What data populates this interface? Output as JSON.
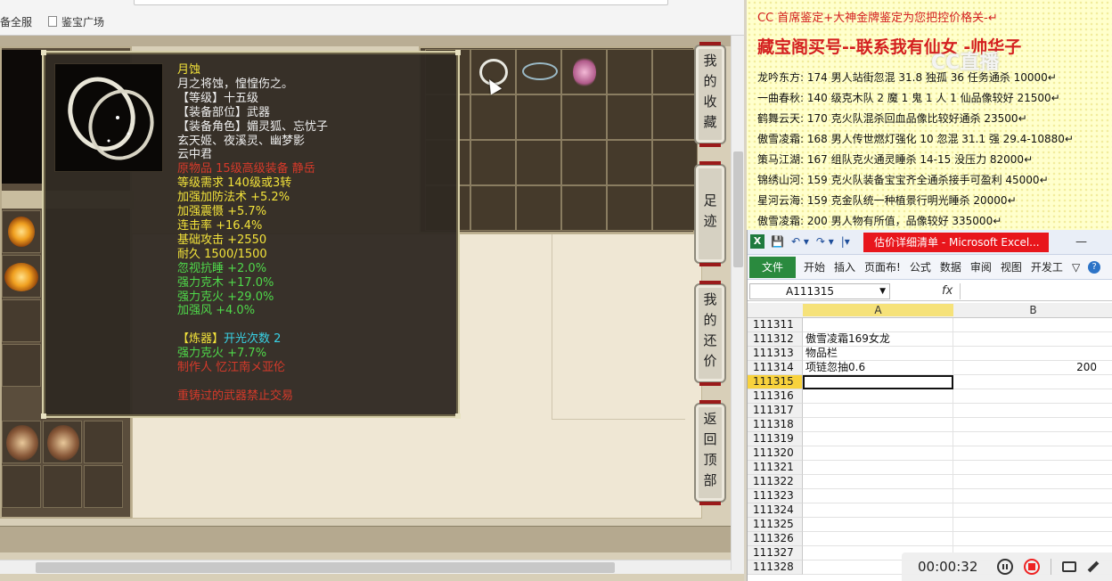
{
  "browser": {
    "bookmarks": [
      {
        "label": "备全服"
      },
      {
        "label": "鉴宝广场"
      }
    ]
  },
  "game": {
    "side_buttons": [
      {
        "label": "我的收藏"
      },
      {
        "label": "足迹"
      },
      {
        "label": "我的还价"
      },
      {
        "label": "返回顶部"
      }
    ],
    "tooltip": {
      "lines": [
        {
          "text": "月蚀",
          "color": "yellow"
        },
        {
          "text": "月之将蚀，惶惶伤之。",
          "color": "white"
        },
        {
          "text": "【等级】十五级",
          "color": "white"
        },
        {
          "text": "【装备部位】武器",
          "color": "white"
        },
        {
          "text": "【装备角色】媚灵狐、忘忧子",
          "color": "white"
        },
        {
          "text": "玄天姬、夜溪灵、幽梦影",
          "color": "white"
        },
        {
          "text": "云中君",
          "color": "white"
        },
        {
          "text": "原物品 15级高级装备 静岳",
          "color": "red"
        },
        {
          "text": "等级需求 140级或3转",
          "color": "yellow"
        },
        {
          "text": "加强加防法术 +5.2%",
          "color": "yellow"
        },
        {
          "text": "加强震慑 +5.7%",
          "color": "yellow"
        },
        {
          "text": "连击率 +16.4%",
          "color": "yellow"
        },
        {
          "text": "基础攻击 +2550",
          "color": "yellow"
        },
        {
          "text": "耐久 1500/1500",
          "color": "yellow"
        },
        {
          "text": "忽视抗睡 +2.0%",
          "color": "green"
        },
        {
          "text": "强力克木 +17.0%",
          "color": "green"
        },
        {
          "text": "强力克火 +29.0%",
          "color": "green"
        },
        {
          "text": "加强风 +4.0%",
          "color": "green"
        },
        {
          "text": "",
          "color": "gap"
        },
        {
          "text": "【炼器】",
          "color": "yellow",
          "extra": "开光次数 2"
        },
        {
          "text": "强力克火 +7.7%",
          "color": "green"
        },
        {
          "text": "制作人 忆江南メ亚伦",
          "color": "red"
        },
        {
          "text": "",
          "color": "gap"
        },
        {
          "text": "重铸过的武器禁止交易",
          "color": "red"
        }
      ]
    }
  },
  "doc": {
    "header1": "CC 首席鉴定+大神金牌鉴定为您把控价格关-↵",
    "header2": "藏宝阁买号--联系我有仙女 -帅华子",
    "rows": [
      "龙吟东方: 174 男人站街忽混 31.8 独孤 36 任务通杀 10000↵",
      "一曲春秋: 140 级克木队 2 魔 1 鬼 1 人 1 仙品像较好 21500↵",
      "鹤舞云天: 170 克火队混杀回血品像比较好通杀 23500↵",
      "傲雪凌霜: 168 男人传世燃灯强化 10 忽混 31.1 强 29.4-10880↵",
      "策马江湖: 167 组队克火通灵睡杀 14-15 没压力 82000↵",
      "锦绣山河: 159 克火队装备宝宝齐全通杀接手可盈利 45000↵",
      "星河云海: 159 克金队统一种植景行明光睡杀 20000↵",
      "傲雪凌霜: 200 男人物有所值，品像较好 335000↵"
    ],
    "watermark": "CC直播"
  },
  "excel": {
    "title": "估价详细清单 - Microsoft Excel...",
    "logo": "X",
    "qat": [
      "💾",
      "↶ ▾",
      "↷ ▾",
      "|▾"
    ],
    "minimize": "—",
    "tabs": [
      "文件",
      "开始",
      "插入",
      "页面布!",
      "公式",
      "数据",
      "审阅",
      "视图",
      "开发工"
    ],
    "ribbon_toggle": "▽",
    "help": "?",
    "namebox": "A111315",
    "fx": "fx",
    "columns": [
      "A",
      "B"
    ],
    "rows": [
      {
        "n": "111311",
        "a": "",
        "b": ""
      },
      {
        "n": "111312",
        "a": "傲雪凌霜169女龙",
        "b": ""
      },
      {
        "n": "111313",
        "a": "物品栏",
        "b": ""
      },
      {
        "n": "111314",
        "a": "项链忽抽0.6",
        "b": "200"
      },
      {
        "n": "111315",
        "a": "",
        "b": "",
        "active": true
      },
      {
        "n": "111316",
        "a": "",
        "b": ""
      },
      {
        "n": "111317",
        "a": "",
        "b": ""
      },
      {
        "n": "111318",
        "a": "",
        "b": ""
      },
      {
        "n": "111319",
        "a": "",
        "b": ""
      },
      {
        "n": "111320",
        "a": "",
        "b": ""
      },
      {
        "n": "111321",
        "a": "",
        "b": ""
      },
      {
        "n": "111322",
        "a": "",
        "b": ""
      },
      {
        "n": "111323",
        "a": "",
        "b": ""
      },
      {
        "n": "111324",
        "a": "",
        "b": ""
      },
      {
        "n": "111325",
        "a": "",
        "b": ""
      },
      {
        "n": "111326",
        "a": "",
        "b": ""
      },
      {
        "n": "111327",
        "a": "",
        "b": ""
      },
      {
        "n": "111328",
        "a": "",
        "b": ""
      }
    ]
  },
  "recorder": {
    "time": "00:00:32"
  },
  "colors": {
    "tooltip_yellow": "#f2e23a",
    "tooltip_red": "#d63a2a",
    "tooltip_green": "#4fd84a",
    "tooltip_cyan": "#39d2e6",
    "doc_red": "#d42020",
    "excel_green": "#2a8a3e",
    "excel_title_red": "#e8161c"
  }
}
